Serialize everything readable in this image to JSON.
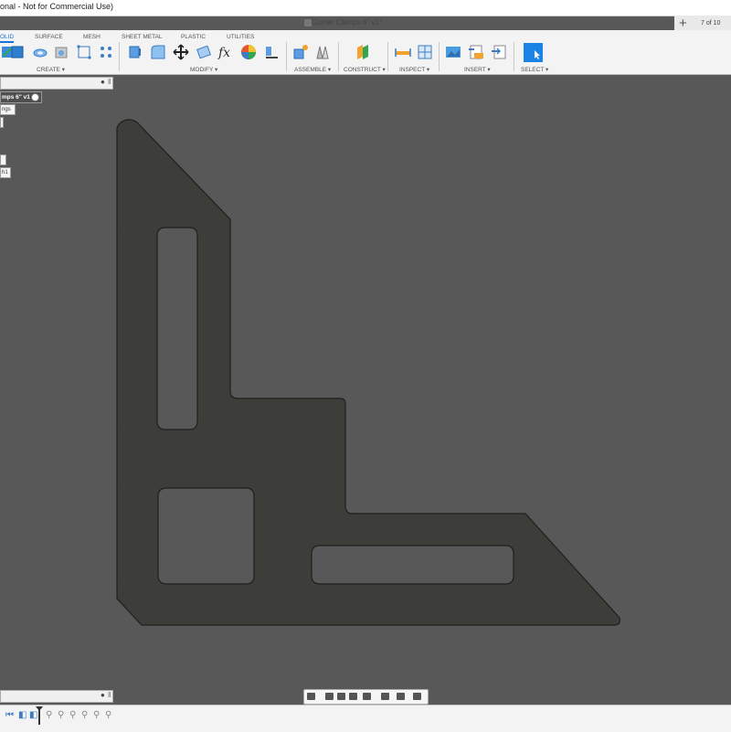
{
  "window": {
    "title_fragment": "onal - Not for Commercial Use)",
    "doc_title": "Corner Clamps 6\" v1*",
    "close_glyph": "×",
    "new_tab_glyph": "+",
    "page_indicator": "7 of 10"
  },
  "toolbar": {
    "tabs": [
      {
        "label": "OLID",
        "active": true
      },
      {
        "label": "SURFACE"
      },
      {
        "label": "MESH"
      },
      {
        "label": "SHEET METAL"
      },
      {
        "label": "PLASTIC"
      },
      {
        "label": "UTILITIES"
      }
    ],
    "groups": {
      "create": "CREATE ▾",
      "modify": "MODIFY ▾",
      "assemble": "ASSEMBLE ▾",
      "construct": "CONSTRUCT ▾",
      "inspect": "INSPECT ▾",
      "insert": "INSERT ▾",
      "select": "SELECT ▾"
    },
    "accent": "#1a73d9"
  },
  "browser": {
    "root_label": "mps 6\" v1",
    "nodes": [
      "ngs",
      "",
      "",
      "h1"
    ]
  },
  "canvas": {
    "background": "#585858",
    "part_fill": "#3d3d3a",
    "hole_fill": "#595959"
  },
  "timeline": {
    "icons": [
      "feature-icon",
      "feature-icon",
      "feature-icon",
      "sketch-icon",
      "sketch-icon",
      "sketch-icon",
      "sketch-icon",
      "sketch-icon"
    ]
  }
}
